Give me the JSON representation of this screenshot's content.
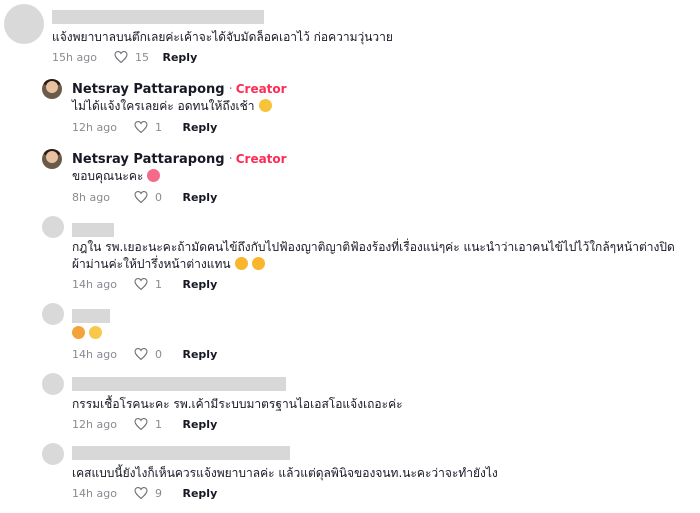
{
  "comments": [
    {
      "text": "แจ้งพยาบาลบนตึกเลยค่ะเค้าจะได้จับมัดล็อคเอาไว้ ก่อความวุ่นวาย",
      "time": "15h ago",
      "likes": "15",
      "reply": "Reply"
    },
    {
      "name": "Netsray Pattarapong",
      "badge": "Creator",
      "text": "ไม่ได้แจ้งใครเลยค่ะ อดทนให้ถึงเช้า",
      "emoji": "sweat-smile-emoji",
      "time": "12h ago",
      "likes": "1",
      "reply": "Reply"
    },
    {
      "name": "Netsray Pattarapong",
      "badge": "Creator",
      "text": "ขอบคุณนะคะ",
      "emoji": "smiling-face-with-hearts-emoji",
      "time": "8h ago",
      "likes": "0",
      "reply": "Reply"
    },
    {
      "line1": "กฎใน รพ.เยอะนะคะถ้ามัดคนไข้ถึงกับไปฟ้องญาติญาติฟ้องร้องที่เรื่องแน่ๆค่ะ แนะนำว่าเอาคนไข้ไปไว้ใกล้ๆหน้าต่างปิด",
      "line2": "ผ้าม่านค่ะให้ปารึ่งหน้าต่างแทน",
      "time": "14h ago",
      "likes": "1",
      "reply": "Reply"
    },
    {
      "time": "14h ago",
      "likes": "0",
      "reply": "Reply"
    },
    {
      "text": "กรรมเชื้อโรคนะคะ รพ.เค้ามีระบบมาตรฐานไอเอสโอแจ้งเถอะค่ะ",
      "time": "12h ago",
      "likes": "1",
      "reply": "Reply"
    },
    {
      "text": "เคสแบบนี้ยังไงก็เห็นควรแจ้งพยาบาลค่ะ แล้วแต่ดุลพินิจของจนท.นะคะว่าจะทำยังไง",
      "time": "14h ago",
      "likes": "9",
      "reply": "Reply"
    }
  ]
}
